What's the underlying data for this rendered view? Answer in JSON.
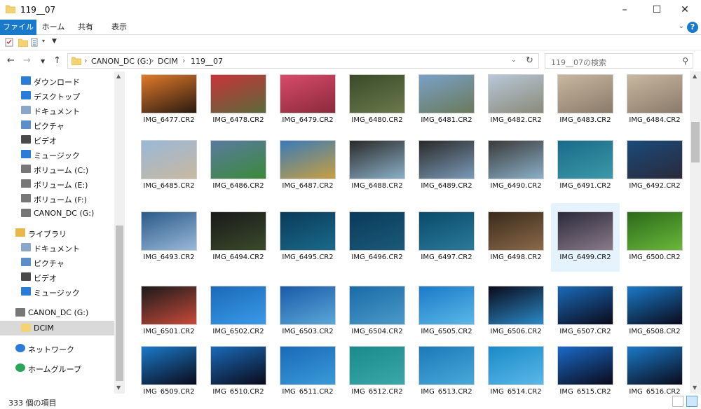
{
  "window": {
    "title": "119__07",
    "buttons": [
      "–",
      "☐",
      "✕"
    ]
  },
  "ribbon": {
    "tabs": [
      "ファイル",
      "ホーム",
      "共有",
      "表示"
    ]
  },
  "address": {
    "crumbs": [
      "CANON_DC (G:)",
      "DCIM",
      "119__07"
    ]
  },
  "search": {
    "placeholder": "119__07の検索"
  },
  "nav": {
    "items": [
      {
        "label": "ダウンロード",
        "icon": "download-icon",
        "color": "#2b7bd8"
      },
      {
        "label": "デスクトップ",
        "icon": "desktop-icon",
        "color": "#2b7bd8"
      },
      {
        "label": "ドキュメント",
        "icon": "document-icon",
        "color": "#8aa6c8"
      },
      {
        "label": "ピクチャ",
        "icon": "pictures-icon",
        "color": "#5b8fc8"
      },
      {
        "label": "ビデオ",
        "icon": "video-icon",
        "color": "#4a4a4a"
      },
      {
        "label": "ミュージック",
        "icon": "music-icon",
        "color": "#2b7bd8"
      },
      {
        "label": "ボリューム (C:)",
        "icon": "drive-icon",
        "color": "#777"
      },
      {
        "label": "ボリューム (E:)",
        "icon": "drive-icon",
        "color": "#777"
      },
      {
        "label": "ボリューム (F:)",
        "icon": "drive-icon",
        "color": "#777"
      },
      {
        "label": "CANON_DC (G:)",
        "icon": "drive-icon",
        "color": "#777"
      },
      {
        "label": "ライブラリ",
        "icon": "library-icon",
        "color": "#e8b84a"
      },
      {
        "label": "ドキュメント",
        "icon": "document-icon",
        "color": "#8aa6c8"
      },
      {
        "label": "ピクチャ",
        "icon": "pictures-icon",
        "color": "#5b8fc8"
      },
      {
        "label": "ビデオ",
        "icon": "video-icon",
        "color": "#4a4a4a"
      },
      {
        "label": "ミュージック",
        "icon": "music-icon",
        "color": "#2b7bd8"
      },
      {
        "label": "CANON_DC (G:)",
        "icon": "drive-icon",
        "color": "#777"
      },
      {
        "label": "DCIM",
        "icon": "folder-icon",
        "color": "#f5d372",
        "selected": true
      },
      {
        "label": "ネットワーク",
        "icon": "network-icon",
        "color": "#2b7bd8"
      },
      {
        "label": "ホームグループ",
        "icon": "homegroup-icon",
        "color": "#2aa55a"
      }
    ]
  },
  "files": {
    "rows": [
      [
        {
          "name": "IMG_6477.CR2",
          "c1": "#e07a2a",
          "c2": "#2a1a10"
        },
        {
          "name": "IMG_6478.CR2",
          "c1": "#c8333a",
          "c2": "#5a6a3a"
        },
        {
          "name": "IMG_6479.CR2",
          "c1": "#d84a6a",
          "c2": "#8a2a3a"
        },
        {
          "name": "IMG_6480.CR2",
          "c1": "#3a4a2a",
          "c2": "#6a7a4a"
        },
        {
          "name": "IMG_6481.CR2",
          "c1": "#7aa0c8",
          "c2": "#6a7a5a"
        },
        {
          "name": "IMG_6482.CR2",
          "c1": "#b8c8d8",
          "c2": "#8a8a7a"
        },
        {
          "name": "IMG_6483.CR2",
          "c1": "#c8b8a0",
          "c2": "#8a7a6a"
        },
        {
          "name": "IMG_6484.CR2",
          "c1": "#c8b8a0",
          "c2": "#8a7a6a"
        }
      ],
      [
        {
          "name": "IMG_6485.CR2",
          "c1": "#9ab8d8",
          "c2": "#c8b8a0"
        },
        {
          "name": "IMG_6486.CR2",
          "c1": "#5a7aa0",
          "c2": "#3a8a3a"
        },
        {
          "name": "IMG_6487.CR2",
          "c1": "#3a7ab8",
          "c2": "#c8a040"
        },
        {
          "name": "IMG_6488.CR2",
          "c1": "#2a2a2a",
          "c2": "#8ab0c8"
        },
        {
          "name": "IMG_6489.CR2",
          "c1": "#2a2a2a",
          "c2": "#7a9ab8"
        },
        {
          "name": "IMG_6490.CR2",
          "c1": "#3a3a3a",
          "c2": "#8ab0c8"
        },
        {
          "name": "IMG_6491.CR2",
          "c1": "#1a6a8a",
          "c2": "#3a9aa8"
        },
        {
          "name": "IMG_6492.CR2",
          "c1": "#1a4a7a",
          "c2": "#2a2a3a"
        }
      ],
      [
        {
          "name": "IMG_6493.CR2",
          "c1": "#2a5a8a",
          "c2": "#9ab8d8"
        },
        {
          "name": "IMG_6494.CR2",
          "c1": "#1a1a1a",
          "c2": "#3a4a2a"
        },
        {
          "name": "IMG_6495.CR2",
          "c1": "#0a3a5a",
          "c2": "#1a6a8a"
        },
        {
          "name": "IMG_6496.CR2",
          "c1": "#0a3a5a",
          "c2": "#1a5a7a"
        },
        {
          "name": "IMG_6497.CR2",
          "c1": "#0a4a6a",
          "c2": "#2a7a9a"
        },
        {
          "name": "IMG_6498.CR2",
          "c1": "#3a2a1a",
          "c2": "#8a6a4a"
        },
        {
          "name": "IMG_6499.CR2",
          "c1": "#2a2a3a",
          "c2": "#8a7a8a",
          "highlight": true
        },
        {
          "name": "IMG_6500.CR2",
          "c1": "#2a6a1a",
          "c2": "#6ab83a"
        }
      ],
      [
        {
          "name": "IMG_6501.CR2",
          "c1": "#1a1a1a",
          "c2": "#c84a3a"
        },
        {
          "name": "IMG_6502.CR2",
          "c1": "#1a6ab8",
          "c2": "#3a9ae8"
        },
        {
          "name": "IMG_6503.CR2",
          "c1": "#1a5aa8",
          "c2": "#5aa8d8"
        },
        {
          "name": "IMG_6504.CR2",
          "c1": "#1a6aa8",
          "c2": "#4a9ac8"
        },
        {
          "name": "IMG_6505.CR2",
          "c1": "#1a7ac8",
          "c2": "#5ab8e8"
        },
        {
          "name": "IMG_6506.CR2",
          "c1": "#0a0a1a",
          "c2": "#2a8ac8"
        },
        {
          "name": "IMG_6507.CR2",
          "c1": "#1a6ab8",
          "c2": "#0a0a1a"
        },
        {
          "name": "IMG_6508.CR2",
          "c1": "#1a7ac8",
          "c2": "#0a0a1a"
        }
      ],
      [
        {
          "name": "IMG_6509.CR2",
          "c1": "#1a7ac8",
          "c2": "#0a0a1a"
        },
        {
          "name": "IMG_6510.CR2",
          "c1": "#1a6ab8",
          "c2": "#0a0a1a"
        },
        {
          "name": "IMG_6511.CR2",
          "c1": "#1a6ab8",
          "c2": "#3a9ad8"
        },
        {
          "name": "IMG_6512.CR2",
          "c1": "#1a8a8a",
          "c2": "#3aa8a8"
        },
        {
          "name": "IMG_6513.CR2",
          "c1": "#1a7ab8",
          "c2": "#4aa8d8"
        },
        {
          "name": "IMG_6514.CR2",
          "c1": "#1a8ac8",
          "c2": "#5ab8e8"
        },
        {
          "name": "IMG_6515.CR2",
          "c1": "#1a6ac8",
          "c2": "#0a0a1a"
        },
        {
          "name": "IMG_6516.CR2",
          "c1": "#1a7ac8",
          "c2": "#0a0a1a"
        }
      ]
    ]
  },
  "status": {
    "count": "333 個の項目"
  }
}
